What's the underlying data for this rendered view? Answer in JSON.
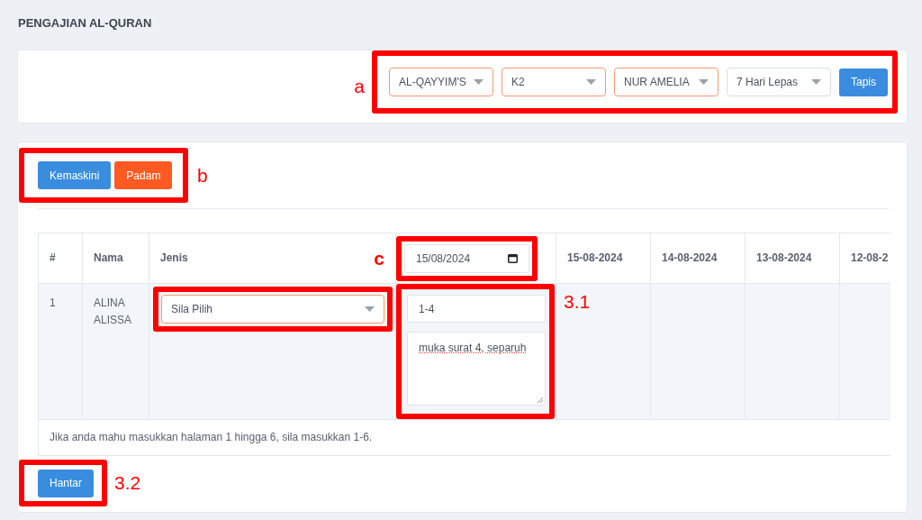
{
  "page_title": "PENGAJIAN AL-QURAN",
  "filters": {
    "annotation": "a",
    "selects": [
      {
        "value": "AL-QAYYIM'S",
        "highlighted": true
      },
      {
        "value": "K2",
        "highlighted": true
      },
      {
        "value": "NUR AMELIA",
        "highlighted": true
      },
      {
        "value": "7 Hari Lepas",
        "highlighted": false
      }
    ],
    "submit": "Tapis"
  },
  "actions": {
    "annotation": "b",
    "buttons": [
      {
        "label": "Kemaskini",
        "kind": "primary"
      },
      {
        "label": "Padam",
        "kind": "danger"
      }
    ]
  },
  "table": {
    "columns": [
      "#",
      "Nama",
      "Jenis"
    ],
    "date_picker": {
      "value": "15/08/2024",
      "annotation": "c"
    },
    "date_columns": [
      "15-08-2024",
      "14-08-2024",
      "13-08-2024",
      "12-08-2"
    ],
    "rows": [
      {
        "number": "1",
        "name": "ALINA ALISSA",
        "type_select": {
          "value": "Sila Pilih",
          "highlighted": true
        },
        "pages": "1-4",
        "note": "muka surat 4, separuh",
        "entry_annotation": "3.1"
      }
    ],
    "footnote": "Jika anda mahu masukkan halaman 1 hingga 6, sila masukkan 1-6."
  },
  "submit": {
    "label": "Hantar",
    "annotation": "3.2"
  }
}
